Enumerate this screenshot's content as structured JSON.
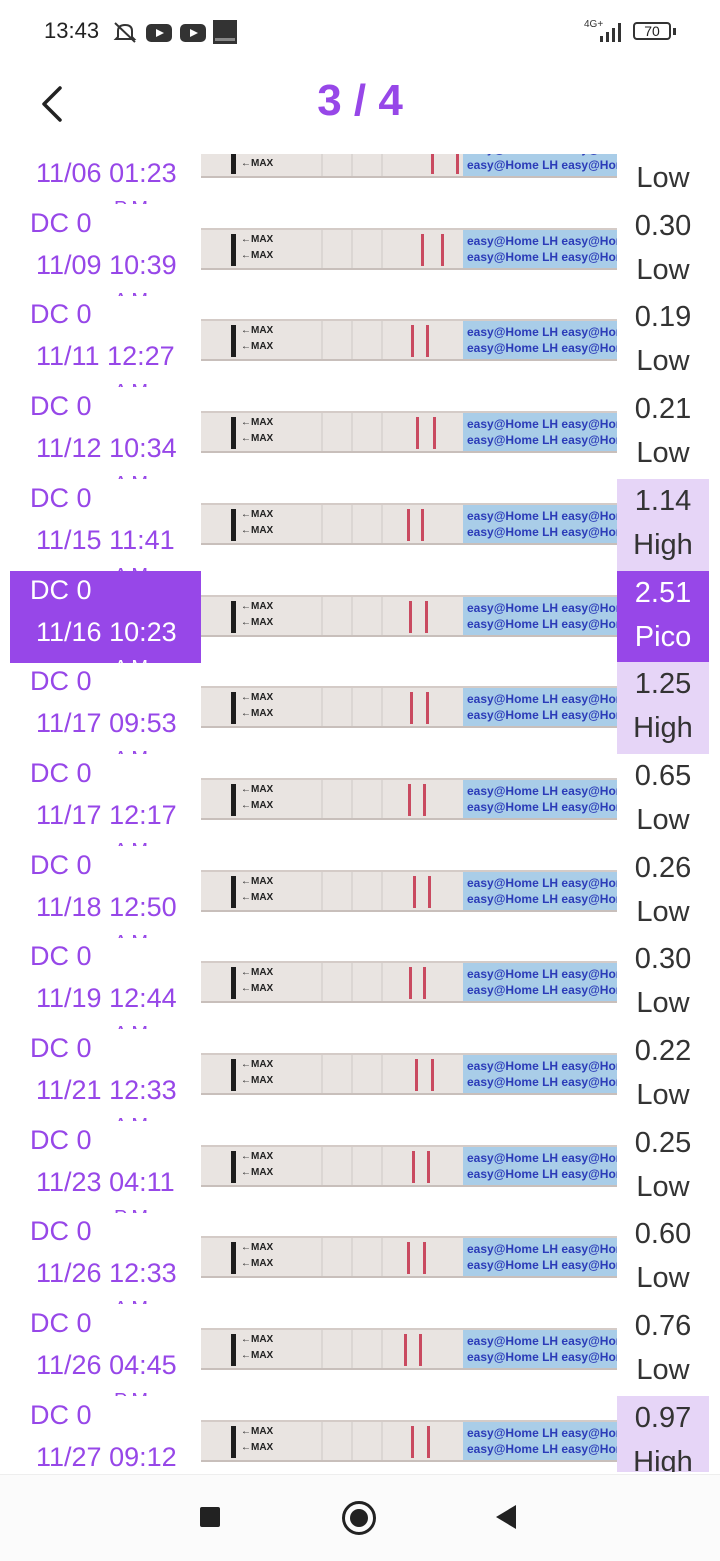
{
  "status_bar": {
    "time": "13:43",
    "network": "4G+",
    "battery": "70",
    "icons": [
      "mute-icon",
      "youtube-icon",
      "youtube-icon",
      "orange-app-icon",
      "signal-icon",
      "battery-icon"
    ]
  },
  "header": {
    "page_counter": "3 / 4",
    "back_icon": "chevron-left-icon"
  },
  "colors": {
    "accent": "#9747e8",
    "high_bg": "#e6d5f7",
    "strip_blue": "#a9cde8",
    "line_red": "#c94a60"
  },
  "rows": [
    {
      "dc": "",
      "datetime": "11/06 01:23",
      "ampm": "PM",
      "value": "",
      "level": "Low",
      "state": "low"
    },
    {
      "dc": "DC 0",
      "datetime": "11/09 10:39",
      "ampm": "AM",
      "value": "0.30",
      "level": "Low",
      "state": "low"
    },
    {
      "dc": "DC 0",
      "datetime": "11/11 12:27",
      "ampm": "AM",
      "value": "0.19",
      "level": "Low",
      "state": "low"
    },
    {
      "dc": "DC 0",
      "datetime": "11/12 10:34",
      "ampm": "AM",
      "value": "0.21",
      "level": "Low",
      "state": "low"
    },
    {
      "dc": "DC 0",
      "datetime": "11/15 11:41",
      "ampm": "AM",
      "value": "1.14",
      "level": "High",
      "state": "high"
    },
    {
      "dc": "DC 0",
      "datetime": "11/16 10:23",
      "ampm": "AM",
      "value": "2.51",
      "level": "Pico",
      "state": "pico"
    },
    {
      "dc": "DC 0",
      "datetime": "11/17 09:53",
      "ampm": "AM",
      "value": "1.25",
      "level": "High",
      "state": "high"
    },
    {
      "dc": "DC 0",
      "datetime": "11/17 12:17",
      "ampm": "AM",
      "value": "0.65",
      "level": "Low",
      "state": "low"
    },
    {
      "dc": "DC 0",
      "datetime": "11/18 12:50",
      "ampm": "AM",
      "value": "0.26",
      "level": "Low",
      "state": "low"
    },
    {
      "dc": "DC 0",
      "datetime": "11/19 12:44",
      "ampm": "AM",
      "value": "0.30",
      "level": "Low",
      "state": "low"
    },
    {
      "dc": "DC 0",
      "datetime": "11/21 12:33",
      "ampm": "AM",
      "value": "0.22",
      "level": "Low",
      "state": "low"
    },
    {
      "dc": "DC 0",
      "datetime": "11/23 04:11",
      "ampm": "PM",
      "value": "0.25",
      "level": "Low",
      "state": "low"
    },
    {
      "dc": "DC 0",
      "datetime": "11/26 12:33",
      "ampm": "AM",
      "value": "0.60",
      "level": "Low",
      "state": "low"
    },
    {
      "dc": "DC 0",
      "datetime": "11/26 04:45",
      "ampm": "PM",
      "value": "0.76",
      "level": "Low",
      "state": "low"
    },
    {
      "dc": "DC 0",
      "datetime": "11/27 09:12",
      "ampm": "",
      "value": "0.97",
      "level": "High",
      "state": "high"
    }
  ],
  "strip": {
    "max_label": "←MAX",
    "brand_text": "easy@Home LH easy@Home LH"
  },
  "nav_bar": {
    "icons": [
      "recents-square-icon",
      "home-circle-icon",
      "back-triangle-icon"
    ]
  }
}
